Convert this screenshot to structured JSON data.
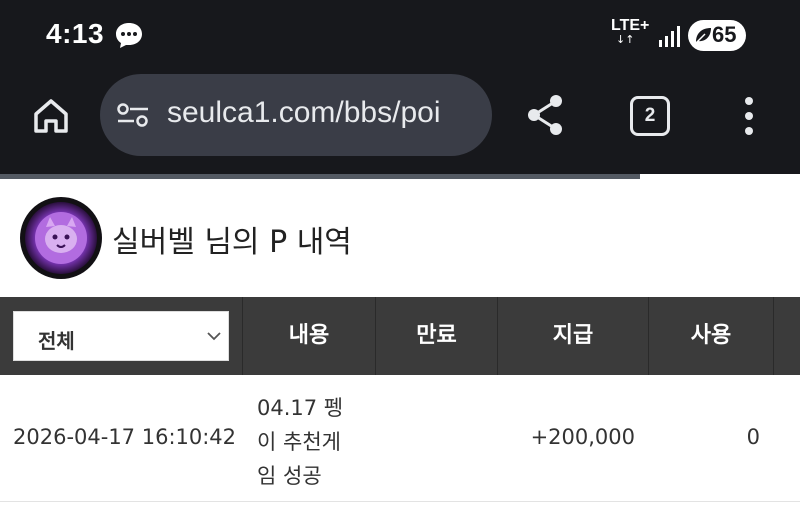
{
  "status": {
    "time": "4:13",
    "network": "LTE+",
    "battery": "65"
  },
  "browser": {
    "url": "seulca1.com/bbs/poi",
    "tab_count": "2",
    "load_progress": 0.8
  },
  "profile": {
    "title": "실버벨 님의 P 내역"
  },
  "table": {
    "filter_selected": "전체",
    "columns": [
      "내용",
      "만료",
      "지급",
      "사용"
    ],
    "rows": [
      {
        "datetime": "2026-04-17 16:10:42",
        "content_lines": [
          "04.17 펭",
          "이 추천게",
          "임 성공"
        ],
        "expiry": "",
        "paid": "+200,000",
        "used": "0"
      }
    ]
  },
  "colors": {
    "browser_bg": "#17181c",
    "url_bar": "#3a3d47",
    "table_header": "#3b3b3b",
    "avatar_accent": "#a25bd6"
  }
}
